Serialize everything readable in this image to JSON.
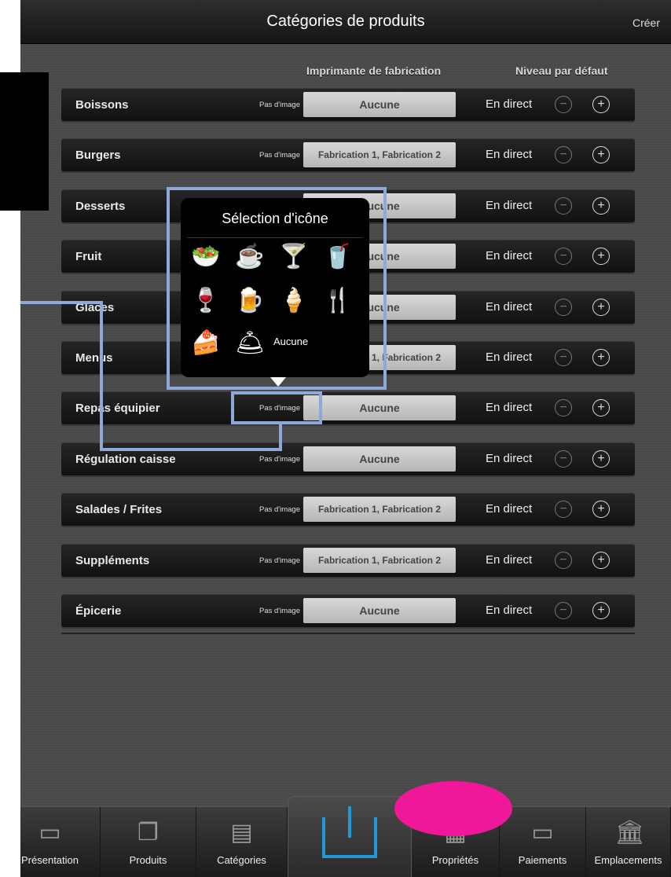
{
  "header": {
    "title": "Catégories de produits",
    "create_label": "Créer"
  },
  "columns": {
    "printer": "Imprimante de fabrication",
    "level": "Niveau par défaut"
  },
  "rows": [
    {
      "name": "Boissons",
      "image": "Pas d'image",
      "printer": "Aucune",
      "level": "En direct"
    },
    {
      "name": "Burgers",
      "image": "Pas d'image",
      "printer": "Fabrication 1, Fabrication 2",
      "level": "En direct"
    },
    {
      "name": "Desserts",
      "image": "",
      "printer": "Aucune",
      "level": "En direct"
    },
    {
      "name": "Fruit",
      "image": "",
      "printer": "Aucune",
      "level": "En direct"
    },
    {
      "name": "Glaces",
      "image": "",
      "printer": "Aucune",
      "level": "En direct"
    },
    {
      "name": "Menus",
      "image": "",
      "printer": "Fabrication 1, Fabrication 2",
      "level": "En direct"
    },
    {
      "name": "Repas équipier",
      "image": "Pas d'image",
      "printer": "Aucune",
      "level": "En direct"
    },
    {
      "name": "Régulation caisse",
      "image": "Pas d'image",
      "printer": "Aucune",
      "level": "En direct"
    },
    {
      "name": "Salades / Frites",
      "image": "Pas d'image",
      "printer": "Fabrication 1, Fabrication 2",
      "level": "En direct"
    },
    {
      "name": "Suppléments",
      "image": "Pas d'image",
      "printer": "Fabrication 1, Fabrication 2",
      "level": "En direct"
    },
    {
      "name": "Épicerie",
      "image": "Pas d'image",
      "printer": "Aucune",
      "level": "En direct"
    }
  ],
  "popover": {
    "title": "Sélection d'icône",
    "icons": [
      "salad-bowl-icon",
      "coffee-cup-icon",
      "cocktail-icon",
      "soda-cup-icon",
      "wine-glass-icon",
      "beer-glass-icon",
      "ice-cream-icon",
      "restaurant-icon",
      "cake-icon",
      "cloche-icon"
    ],
    "none_label": "Aucune"
  },
  "tabs": [
    {
      "label": "Présentation",
      "icon": "presentation-icon"
    },
    {
      "label": "Produits",
      "icon": "documents-icon"
    },
    {
      "label": "Catégories",
      "icon": "cabinet-icon"
    },
    {
      "label": "",
      "icon": "power-icon"
    },
    {
      "label": "Propriétés",
      "icon": "properties-icon"
    },
    {
      "label": "Paiements",
      "icon": "card-icon"
    },
    {
      "label": "Emplacements",
      "icon": "bank-icon"
    }
  ],
  "colors": {
    "accent": "#1e9ad6",
    "highlight": "#8ea9d8",
    "marker": "#ef189a"
  }
}
